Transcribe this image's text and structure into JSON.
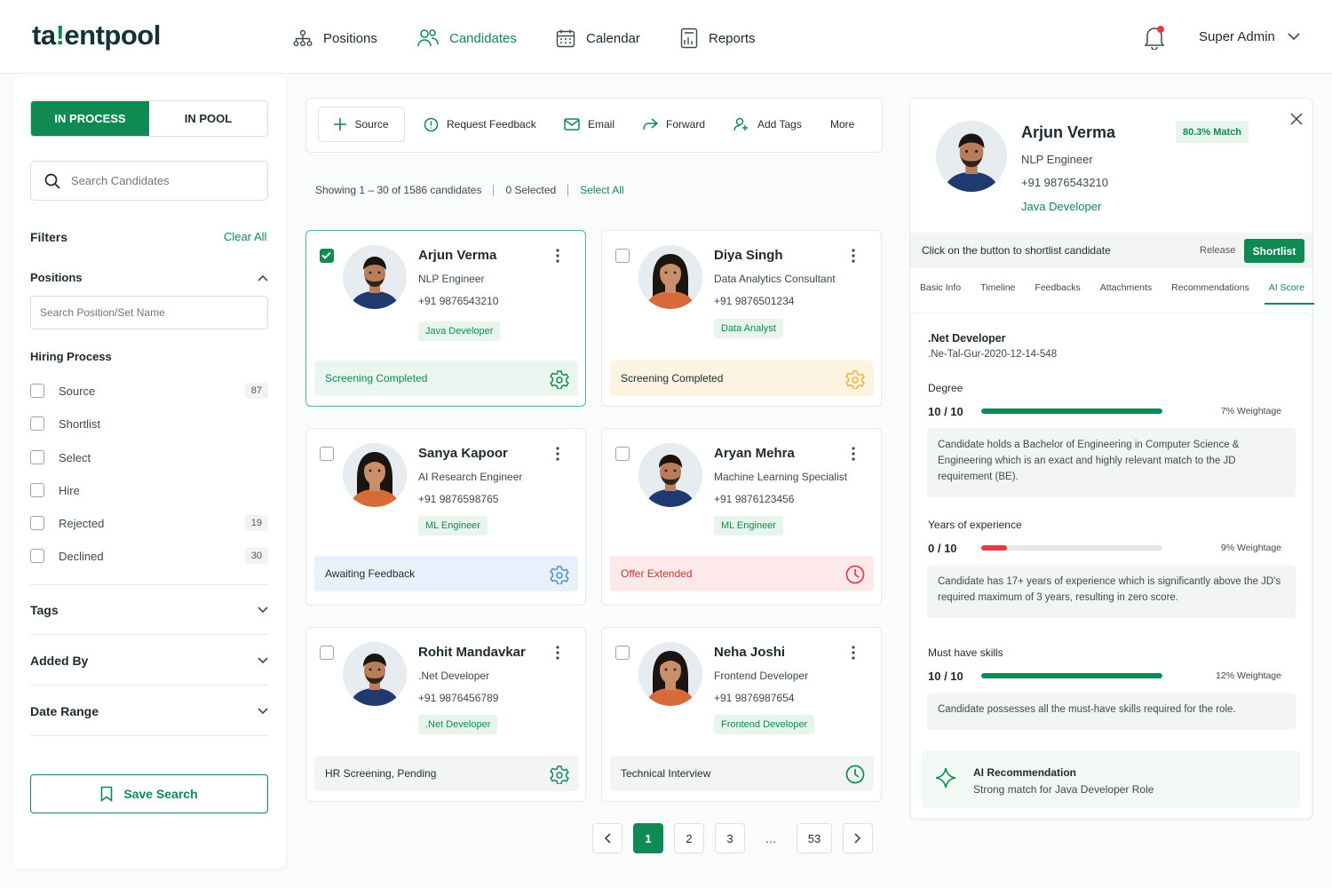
{
  "header": {
    "logo_pre": "ta",
    "logo_mid": "!",
    "logo_post": "entpool",
    "nav": [
      {
        "label": "Positions",
        "icon": "org-chart-icon"
      },
      {
        "label": "Candidates",
        "icon": "people-icon"
      },
      {
        "label": "Calendar",
        "icon": "calendar-icon"
      },
      {
        "label": "Reports",
        "icon": "report-icon"
      }
    ],
    "active_nav": "Candidates",
    "user_name": "Super Admin"
  },
  "sidebar": {
    "segment": [
      "IN PROCESS",
      "IN POOL"
    ],
    "search_placeholder": "Search Candidates",
    "filters_title": "Filters",
    "clear_all": "Clear All",
    "positions_title": "Positions",
    "position_placeholder": "Search Position/Set Name",
    "hiring_title": "Hiring Process",
    "hiring": [
      {
        "label": "Source",
        "count": "87"
      },
      {
        "label": "Shortlist",
        "count": ""
      },
      {
        "label": "Select",
        "count": ""
      },
      {
        "label": "Hire",
        "count": ""
      },
      {
        "label": "Rejected",
        "count": "19"
      },
      {
        "label": "Declined",
        "count": "30"
      }
    ],
    "sections": [
      "Tags",
      "Added By",
      "Date Range"
    ],
    "save_search": "Save Search"
  },
  "toolbar": {
    "items": [
      "Source",
      "Request Feedback",
      "Email",
      "Forward",
      "Add Tags",
      "More"
    ]
  },
  "listing": {
    "showing": "Showing 1 – 30 of 1586 candidates",
    "selected": "0 Selected",
    "select_all": "Select All"
  },
  "candidates": [
    {
      "name": "Arjun Verma",
      "role": "NLP Engineer",
      "phone": "+91 9876543210",
      "tag": "Java Developer",
      "status": "Screening Completed",
      "checked": true,
      "gender": "m"
    },
    {
      "name": "Diya Singh",
      "role": "Data Analytics Consultant",
      "phone": "+91 9876501234",
      "tag": "Data Analyst",
      "status": "Screening Completed",
      "checked": false,
      "gender": "f"
    },
    {
      "name": "Sanya Kapoor",
      "role": "AI Research Engineer",
      "phone": "+91 9876598765",
      "tag": "ML Engineer",
      "status": "Awaiting Feedback",
      "checked": false,
      "gender": "f"
    },
    {
      "name": "Aryan Mehra",
      "role": "Machine Learning Specialist",
      "phone": "+91 9876123456",
      "tag": "ML Engineer",
      "status": "Offer Extended",
      "checked": false,
      "gender": "m"
    },
    {
      "name": "Rohit Mandavkar",
      "role": ".Net Developer",
      "phone": "+91 9876456789",
      "tag": ".Net Developer",
      "status": "HR Screening, Pending",
      "checked": false,
      "gender": "m"
    },
    {
      "name": "Neha Joshi",
      "role": "Frontend Developer",
      "phone": "+91 9876987654",
      "tag": "Frontend Developer",
      "status": "Technical Interview",
      "checked": false,
      "gender": "f"
    }
  ],
  "pagination": [
    "1",
    "2",
    "3",
    "…",
    "53"
  ],
  "current_page": "1",
  "detail": {
    "name": "Arjun Verma",
    "role": "NLP Engineer",
    "phone": "+91 9876543210",
    "tag": "Java Developer",
    "match": "80.3% Match",
    "shortlist_prompt": "Click on the button to shortlist candidate",
    "release": "Release",
    "shortlist": "Shortlist",
    "tabs": [
      "Basic Info",
      "Timeline",
      "Feedbacks",
      "Attachments",
      "Recommendations",
      "AI Score"
    ],
    "active_tab": "AI Score",
    "job_title": ".Net Developer",
    "job_code": ".Ne-Tal-Gur-2020-12-14-548",
    "scores": [
      {
        "name": "Degree",
        "score": "10 / 10",
        "fraction": 1.0,
        "weight": "7% Weightage",
        "note": "Candidate holds a Bachelor of Engineering in Computer Science & Engineering which is an exact and highly relevant match to the JD requirement (BE)."
      },
      {
        "name": "Years of experience",
        "score": "0 / 10",
        "fraction": 0.0,
        "weight": "9% Weightage",
        "note": "Candidate has 17+ years of experience which is significantly above the JD's required maximum of 3 years, resulting in zero score."
      },
      {
        "name": "Must have skills",
        "score": "10 / 10",
        "fraction": 1.0,
        "weight": "12% Weightage",
        "note": "Candidate possesses all the must-have skills required for the role."
      }
    ],
    "ai_title": "AI Recommendation",
    "ai_text": "Strong match for Java Developer Role"
  },
  "colors": {
    "brand": "#0e8a52",
    "danger": "#e63946",
    "warning": "#f2b134",
    "info": "#4a8fd8"
  }
}
